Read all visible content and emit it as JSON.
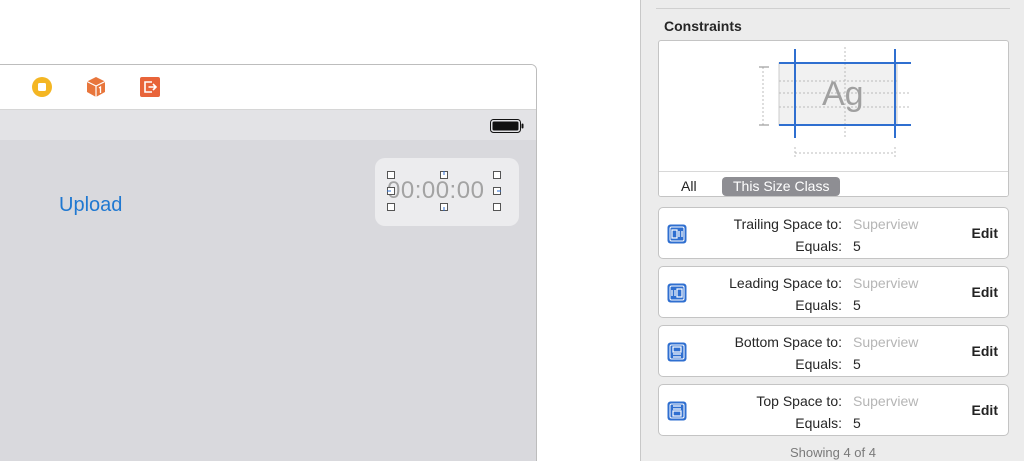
{
  "canvas": {
    "upload_button_label": "Upload",
    "timer_label": "00:00:00",
    "dock_icons": [
      "view-controller-icon",
      "first-responder-icon",
      "exit-icon"
    ]
  },
  "inspector": {
    "section_title": "Constraints",
    "diagram_sample_text": "Ag",
    "size_class_options": [
      "All",
      "This Size Class"
    ],
    "selected_size_class": "This Size Class",
    "constraints": [
      {
        "type_label": "Trailing Space to:",
        "target": "Superview",
        "equals_label": "Equals:",
        "value": "5",
        "edit_label": "Edit",
        "icon": "trailing-space-icon"
      },
      {
        "type_label": "Leading Space to:",
        "target": "Superview",
        "equals_label": "Equals:",
        "value": "5",
        "edit_label": "Edit",
        "icon": "leading-space-icon"
      },
      {
        "type_label": "Bottom Space to:",
        "target": "Superview",
        "equals_label": "Equals:",
        "value": "5",
        "edit_label": "Edit",
        "icon": "bottom-space-icon"
      },
      {
        "type_label": "Top Space to:",
        "target": "Superview",
        "equals_label": "Equals:",
        "value": "5",
        "edit_label": "Edit",
        "icon": "top-space-icon"
      }
    ],
    "showing_label": "Showing 4 of 4"
  },
  "colors": {
    "accent_blue": "#1f78d1",
    "constraint_icon_blue": "#2f6fd0",
    "view_controller_yellow": "#f4b623",
    "first_responder_orange": "#e8763c",
    "exit_orange": "#e8643a"
  }
}
